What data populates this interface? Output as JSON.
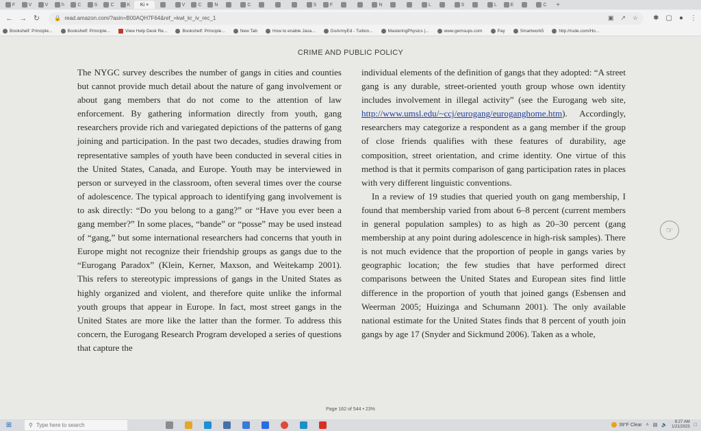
{
  "browser": {
    "tabs": [
      {
        "label": "F"
      },
      {
        "label": "V"
      },
      {
        "label": "V"
      },
      {
        "label": "h"
      },
      {
        "label": "C"
      },
      {
        "label": "S"
      },
      {
        "label": "C"
      },
      {
        "label": "K"
      },
      {
        "label": ""
      },
      {
        "label": "V"
      },
      {
        "label": "C"
      },
      {
        "label": "N"
      },
      {
        "label": ""
      },
      {
        "label": "C"
      },
      {
        "label": ""
      },
      {
        "label": ""
      },
      {
        "label": ""
      },
      {
        "label": "S"
      },
      {
        "label": "F"
      },
      {
        "label": ""
      },
      {
        "label": ""
      },
      {
        "label": "N"
      },
      {
        "label": ""
      },
      {
        "label": ""
      },
      {
        "label": "L"
      },
      {
        "label": ""
      },
      {
        "label": "S"
      },
      {
        "label": ""
      },
      {
        "label": "L"
      },
      {
        "label": "E"
      },
      {
        "label": ""
      },
      {
        "label": "C"
      }
    ],
    "active_tab_label": "Ki",
    "url": "read.amazon.com/?asin=B00AQH7F64&ref_=kwl_kr_iv_rec_1",
    "bookmarks": [
      {
        "label": "Bookshelf: Principle...",
        "icon": "bookshelf-icon"
      },
      {
        "label": "Bookshelf: Principle...",
        "icon": "bookshelf-icon"
      },
      {
        "label": "View Help Desk Re...",
        "icon": "helpdesk-icon"
      },
      {
        "label": "Bookshelf: Principle...",
        "icon": "bookshelf-icon"
      },
      {
        "label": "New Tab",
        "icon": "globe-icon"
      },
      {
        "label": "How to enable Java...",
        "icon": "java-icon"
      },
      {
        "label": "GoArmyEd - Tuition...",
        "icon": "globe-icon"
      },
      {
        "label": "MasteringPhysics |...",
        "icon": "mastering-icon"
      },
      {
        "label": "www.gemsups.com",
        "icon": "globe-icon"
      },
      {
        "label": "Pay",
        "icon": "globe-icon"
      },
      {
        "label": "Smartwork5",
        "icon": "globe-icon"
      },
      {
        "label": "http://rude.com/Ho...",
        "icon": "globe-icon"
      }
    ]
  },
  "reader": {
    "running_head": "CRIME AND PUBLIC POLICY",
    "left_column": [
      "The NYGC survey describes the number of gangs in cities and counties but cannot provide much detail about the nature of gang involvement or about gang members that do not come to the attention of law enforcement. By gathering information directly from youth, gang researchers provide rich and variegated depictions of the patterns of gang joining and participation. In the past two decades, studies drawing from representative samples of youth have been conducted in several cities in the United States, Canada, and Europe. Youth may be interviewed in person or surveyed in the classroom, often several times over the course of adolescence. The typical approach to identifying gang involvement is to ask directly: “Do you belong to a gang?” or “Have you ever been a gang member?” In some places, “bande” or “posse” may be used instead of “gang,” but some international researchers had concerns that youth in Europe might not recognize their friendship groups as gangs due to the “Eurogang Paradox” (Klein, Kerner, Maxson, and Weitekamp 2001). This refers to stereotypic impressions of gangs in the United States as highly organized and violent, and therefore quite unlike the informal youth groups that appear in Europe. In fact, most street gangs in the United States are more like the latter than the former. To address this concern, the Eurogang Research Program developed a series of questions that capture the"
    ],
    "right_p1_before_link": "individual elements of the definition of gangs that they adopted: “A street gang is any durable, street-oriented youth group whose own identity includes involvement in illegal activity” (see the Eurogang web site, ",
    "right_p1_link": "http://www.umsl.edu/~ccj/eurogang/euroganghome.htm",
    "right_p1_after_link": "). Accordingly, researchers may categorize a respondent as a gang member if the group of close friends qualifies with these features of durability, age composition, street orientation, and crime identity. One virtue of this method is that it permits comparison of gang participation rates in places with very different linguistic conventions.",
    "right_p2": "In a review of 19 studies that queried youth on gang membership, I found that membership varied from about 6–8 percent (current members in general population samples) to as high as 20–30 percent (gang membership at any point during adolescence in high-risk samples). There is not much evidence that the proportion of people in gangs varies by geographic location; the few studies that have performed direct comparisons between the United States and European sites find little difference in the proportion of youth that joined gangs (Esbensen and Weerman 2005; Huizinga and Schumann 2001). The only available national estimate for the United States finds that 8 percent of youth join gangs by age 17 (Snyder and Sickmund 2006). Taken as a whole,",
    "page_indicator": "Page 162 of 544 • 23%"
  },
  "taskbar": {
    "search_placeholder": "Type here to search",
    "weather": "39°F Clear",
    "time": "8:27 AM",
    "date": "1/21/2023"
  },
  "colors": {
    "page_background": "#e9e9e6",
    "link": "#1f3f9e",
    "body_text": "#2a2a2a"
  }
}
